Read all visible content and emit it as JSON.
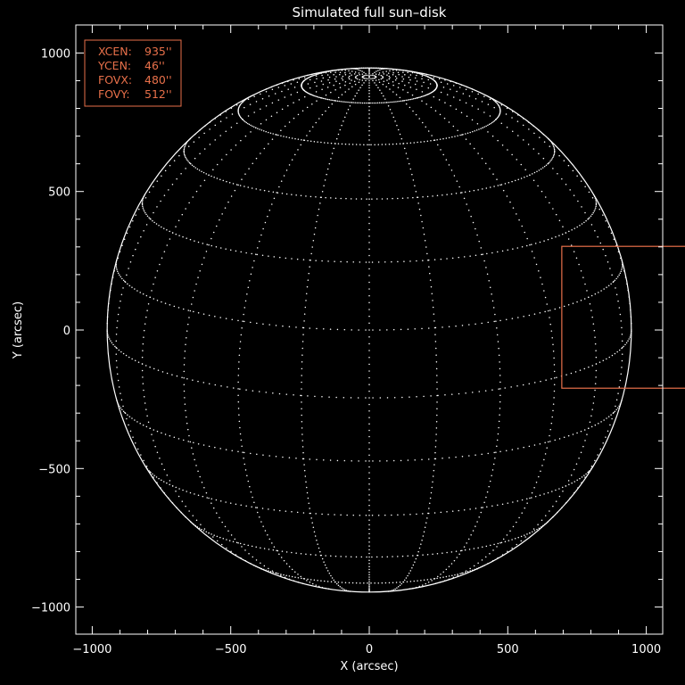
{
  "chart_data": {
    "type": "scatter",
    "title": "Simulated full sun–disk",
    "xlabel": "X (arcsec)",
    "ylabel": "Y (arcsec)",
    "xlim": [
      -1100,
      1100
    ],
    "ylim": [
      -1100,
      1100
    ],
    "xticks": [
      -1000,
      -500,
      0,
      500,
      1000
    ],
    "yticks": [
      -1000,
      -500,
      0,
      500,
      1000
    ],
    "xtick_labels": [
      "−1000",
      "−500",
      "0",
      "500",
      "1000"
    ],
    "ytick_labels": [
      "−1000",
      "−500",
      "0",
      "500",
      "1000"
    ],
    "solar_radius_arcsec": 946,
    "b0_angle_deg": 15,
    "grid_spacing_deg": 15,
    "field_of_view": {
      "xcen": 935,
      "ycen": 46,
      "fovx": 480,
      "fovy": 512,
      "color": "#e8704a"
    },
    "info_box": [
      {
        "key": "XCEN:",
        "value": "935''"
      },
      {
        "key": "YCEN:",
        "value": "46''"
      },
      {
        "key": "FOVX:",
        "value": "480''"
      },
      {
        "key": "FOVY:",
        "value": "512''"
      }
    ],
    "colors": {
      "background": "#000000",
      "foreground": "#ffffff",
      "accent": "#e8704a"
    }
  }
}
